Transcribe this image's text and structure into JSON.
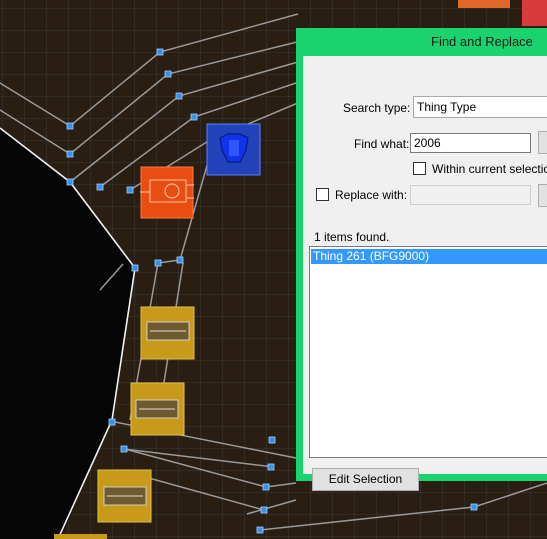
{
  "dialog": {
    "title": "Find and Replace",
    "search_type_label": "Search type:",
    "search_type_value": "Thing Type",
    "find_what_label": "Find what:",
    "find_what_value": "2006",
    "within_selection_label": "Within current selection",
    "within_selection_checked": false,
    "replace_with_label": "Replace with:",
    "replace_with_checked": false,
    "replace_with_value": "",
    "results_count": "1 items found.",
    "results": [
      "Thing 261 (BFG9000)"
    ],
    "edit_selection_label": "Edit Selection"
  },
  "colors": {
    "dialog_frame": "#19d46e",
    "selection": "#3399ff",
    "map_background": "#0c0c0c",
    "vertex": "#3a8fe8",
    "linedef": "#9a9a9a"
  },
  "icons": [
    "armor-thing-icon",
    "bfg9000-thing-icon",
    "ammo-box-thing-icon"
  ]
}
